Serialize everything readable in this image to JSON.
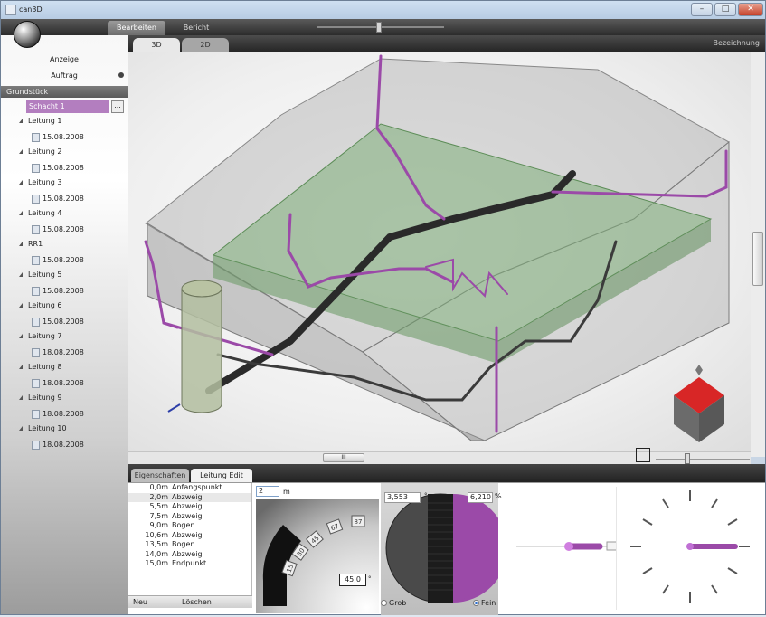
{
  "window": {
    "title": "can3D",
    "minimize": "–",
    "maximize": "□",
    "close": "✕"
  },
  "toolbar": {
    "tabs": [
      "Bearbeiten",
      "Bericht"
    ]
  },
  "sidebar": {
    "nav": [
      "Anzeige",
      "Auftrag"
    ],
    "tree_header": "Grundstück",
    "selected": "Schacht 1",
    "more_button": "...",
    "items": [
      {
        "name": "Leitung 1",
        "date": "15.08.2008"
      },
      {
        "name": "Leitung 2",
        "date": "15.08.2008"
      },
      {
        "name": "Leitung 3",
        "date": "15.08.2008"
      },
      {
        "name": "Leitung 4",
        "date": "15.08.2008"
      },
      {
        "name": "RR1",
        "date": "15.08.2008"
      },
      {
        "name": "Leitung 5",
        "date": "15.08.2008"
      },
      {
        "name": "Leitung 6",
        "date": "15.08.2008"
      },
      {
        "name": "Leitung 7",
        "date": "18.08.2008"
      },
      {
        "name": "Leitung 8",
        "date": "18.08.2008"
      },
      {
        "name": "Leitung 9",
        "date": "18.08.2008"
      },
      {
        "name": "Leitung 10",
        "date": "18.08.2008"
      }
    ]
  },
  "view": {
    "tabs": [
      "3D",
      "2D"
    ],
    "label": "Bezeichnung",
    "hscroll_label": "III"
  },
  "bottom": {
    "tabs": [
      "Eigenschaften",
      "Leitung Edit"
    ],
    "points": [
      {
        "dist": "0,0m",
        "type": "Anfangspunkt"
      },
      {
        "dist": "2,0m",
        "type": "Abzweig"
      },
      {
        "dist": "5,5m",
        "type": "Abzweig"
      },
      {
        "dist": "7,5m",
        "type": "Abzweig"
      },
      {
        "dist": "9,0m",
        "type": "Bogen"
      },
      {
        "dist": "10,6m",
        "type": "Abzweig"
      },
      {
        "dist": "13,5m",
        "type": "Bogen"
      },
      {
        "dist": "14,0m",
        "type": "Abzweig"
      },
      {
        "dist": "15,0m",
        "type": "Endpunkt"
      }
    ],
    "new_button": "Neu",
    "delete_button": "Löschen",
    "length_value": "2",
    "length_unit": "m",
    "angle_labels": [
      "15",
      "30",
      "45",
      "67",
      "87"
    ],
    "angle_value": "45,0",
    "angle_unit": "°",
    "grob_value": "3,553",
    "grob_unit": "°",
    "fein_value": "6,210",
    "fein_unit": "%",
    "grob_label": "Grob",
    "fein_label": "Fein"
  },
  "colors": {
    "accent": "#b37ebf",
    "pipe": "#9b4aa8",
    "soil": "#8fb38a"
  }
}
